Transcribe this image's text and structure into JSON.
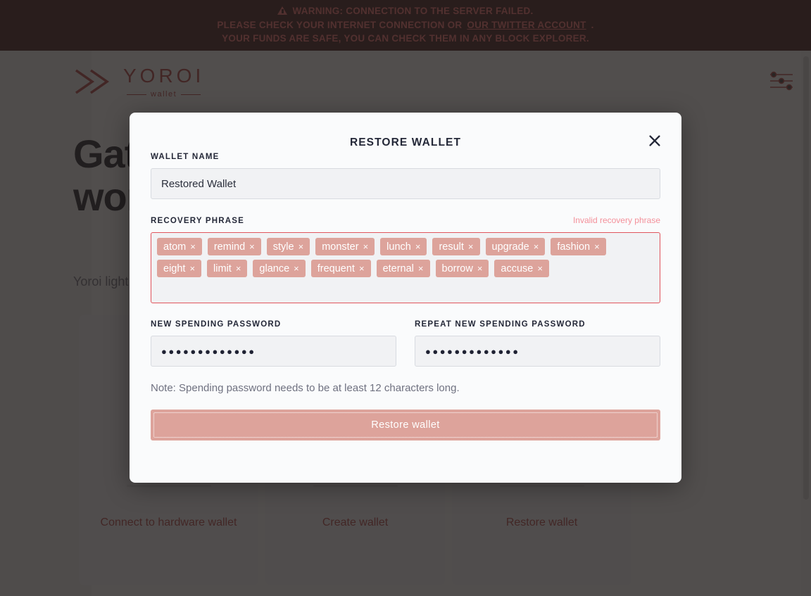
{
  "banner": {
    "line1": "Warning: Connection to the server failed.",
    "line2_prefix": "Please check your internet connection or ",
    "line2_link": "our Twitter account",
    "line2_suffix": ".",
    "line3": "Your funds are safe, you can check them in any block explorer.",
    "bg_color": "#3b0a0a",
    "text_color": "#ff6b6b"
  },
  "header": {
    "logo_word": "YOROI",
    "logo_sub": "wallet",
    "settings_icon": "sliders-icon"
  },
  "hero": {
    "title": "Gateway to the financial world",
    "subtitle": "Yoroi light wallet for Cardano"
  },
  "cards": [
    {
      "label": "Connect to hardware wallet",
      "art": "hardware-wallet-icon"
    },
    {
      "label": "Create wallet",
      "art": "create-wallet-icon"
    },
    {
      "label": "Restore wallet",
      "art": "restore-wallet-icon"
    }
  ],
  "modal": {
    "title": "Restore wallet",
    "close_icon": "close-icon",
    "wallet_name": {
      "label": "Wallet name",
      "value": "Restored Wallet"
    },
    "recovery_phrase": {
      "label": "Recovery phrase",
      "error": "Invalid recovery phrase",
      "error_color": "#f4909a",
      "chip_color": "#dda39b",
      "remove_glyph": "×",
      "words": [
        "atom",
        "remind",
        "style",
        "monster",
        "lunch",
        "result",
        "upgrade",
        "fashion",
        "eight",
        "limit",
        "glance",
        "frequent",
        "eternal",
        "borrow",
        "accuse"
      ]
    },
    "new_password": {
      "label": "New spending password",
      "masked_value": "●●●●●●●●●●●●●"
    },
    "repeat_password": {
      "label": "Repeat new spending password",
      "masked_value": "●●●●●●●●●●●●●"
    },
    "note": "Note: Spending password needs to be at least 12 characters long.",
    "submit_label": "Restore wallet",
    "submit_color": "#dda39b"
  }
}
